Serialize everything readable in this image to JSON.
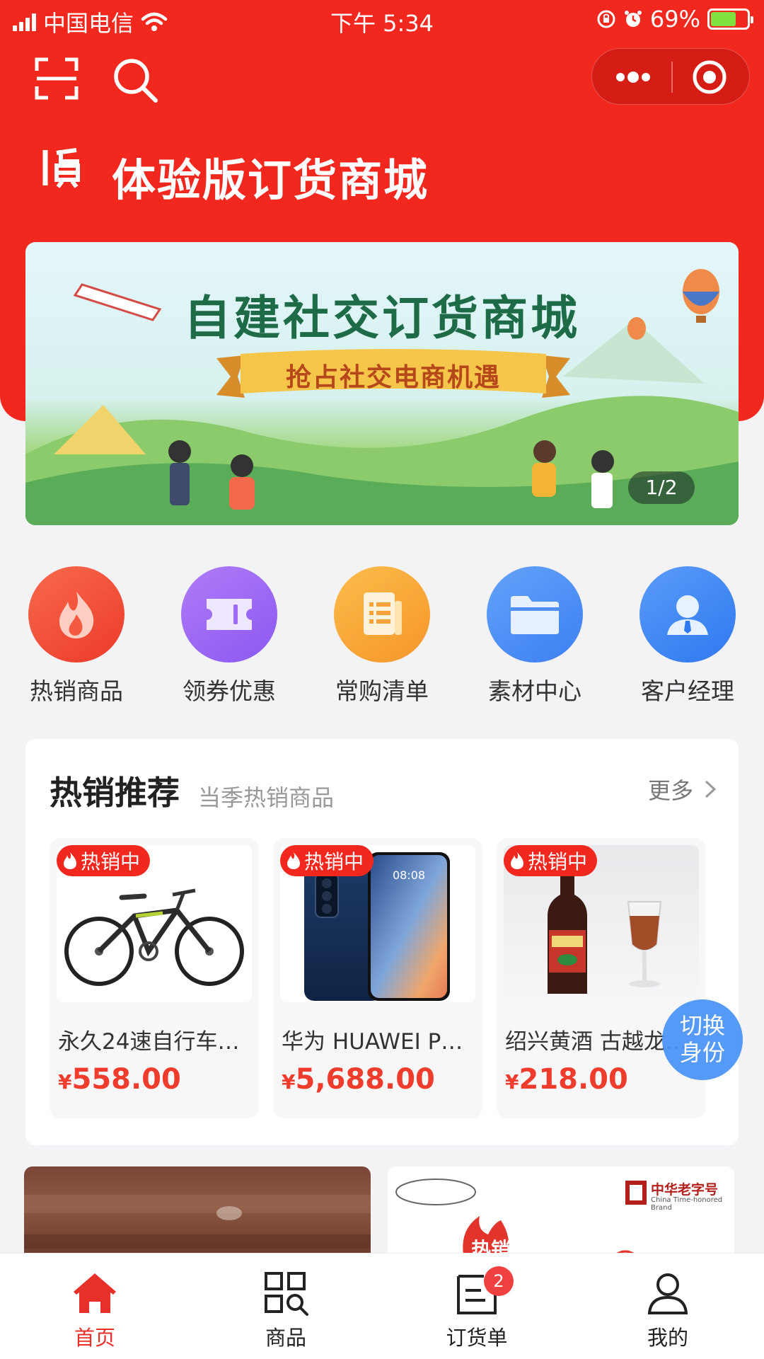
{
  "status_bar": {
    "carrier": "中国电信",
    "time": "下午 5:34",
    "battery": "69%",
    "battery_level": 0.69
  },
  "header": {
    "store_title": "体验版订货商城"
  },
  "banner": {
    "title": "自建社交订货商城",
    "subtitle": "抢占社交电商机遇",
    "indicator": "1/2"
  },
  "quick_nav": [
    {
      "label": "热销商品",
      "icon": "flame-icon",
      "color": "#f4513a"
    },
    {
      "label": "领券优惠",
      "icon": "coupon-icon",
      "color": "#9b6bf4"
    },
    {
      "label": "常购清单",
      "icon": "list-icon",
      "color": "#f9a533"
    },
    {
      "label": "素材中心",
      "icon": "folder-icon",
      "color": "#4e8ff7"
    },
    {
      "label": "客户经理",
      "icon": "manager-icon",
      "color": "#3d89f5"
    }
  ],
  "hot_section": {
    "title": "热销推荐",
    "subtitle": "当季热销商品",
    "more": "更多",
    "products": [
      {
        "tag": "热销中",
        "name": "永久24速自行车…",
        "currency": "¥",
        "price": "558.00"
      },
      {
        "tag": "热销中",
        "name": "华为 HUAWEI P4…",
        "currency": "¥",
        "price": "5,688.00"
      },
      {
        "tag": "热销中",
        "name": "绍兴黄酒 古越龙…",
        "currency": "¥",
        "price": "218.00"
      }
    ]
  },
  "switch_role": {
    "line1": "切换",
    "line2": "身份"
  },
  "promos": {
    "brand": "中华老字号",
    "brand_en": "China Time-honored Brand",
    "hot": "热销"
  },
  "tab_bar": {
    "tabs": [
      {
        "label": "首页",
        "icon": "home-icon",
        "active": true
      },
      {
        "label": "商品",
        "icon": "products-icon",
        "active": false
      },
      {
        "label": "订货单",
        "icon": "order-icon",
        "active": false,
        "badge": "2"
      },
      {
        "label": "我的",
        "icon": "profile-icon",
        "active": false
      }
    ]
  },
  "colors": {
    "brand_red": "#f2281f",
    "price_red": "#ef3c2d",
    "page_bg": "#f3f3f5"
  }
}
